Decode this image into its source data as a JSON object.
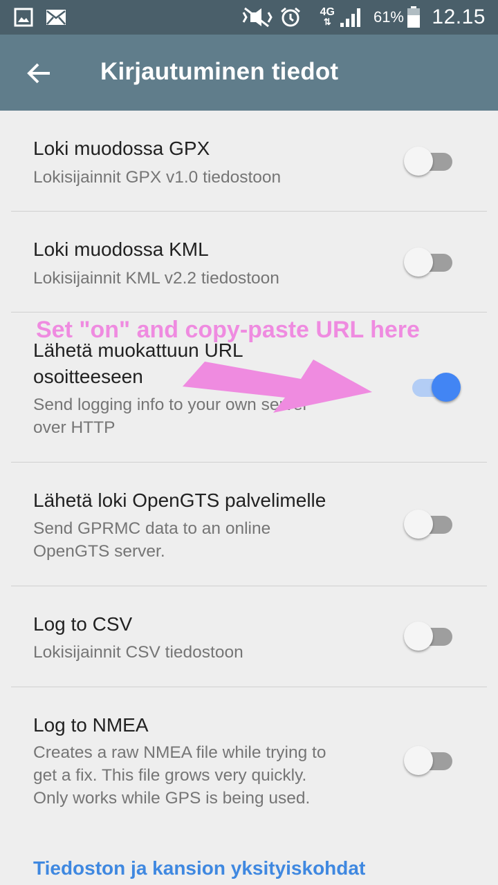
{
  "status_bar": {
    "network": "4G",
    "battery_percent": "61%",
    "time": "12.15",
    "icons": [
      "gallery-icon",
      "mail-icon",
      "mute-icon",
      "alarm-icon",
      "signal-icon",
      "battery-icon"
    ]
  },
  "app_bar": {
    "title": "Kirjautuminen tiedot",
    "back_icon": "arrow-back-icon"
  },
  "colors": {
    "status_bar": "#4a5f6a",
    "app_bar": "#607d8b",
    "switch_on": "#4285f4",
    "annotation": "#ef8be0",
    "link": "#3f88e0"
  },
  "preferences": [
    {
      "title": "Loki muodossa GPX",
      "summary": "Lokisijainnit GPX v1.0 tiedostoon",
      "enabled": false
    },
    {
      "title": "Loki muodossa KML",
      "summary": "Lokisijainnit KML v2.2 tiedostoon",
      "enabled": false
    },
    {
      "title": "Lähetä muokattuun URL\nosoitteeseen",
      "summary": "Send logging info to your own server\nover HTTP",
      "enabled": true
    },
    {
      "title": "Lähetä loki OpenGTS palvelimelle",
      "summary": "Send GPRMC data to an online\nOpenGTS server.",
      "enabled": false
    },
    {
      "title": "Log to CSV",
      "summary": "Lokisijainnit CSV tiedostoon",
      "enabled": false
    },
    {
      "title": "Log to NMEA",
      "summary": "Creates a raw NMEA file while trying to\nget a fix. This file grows very quickly.\nOnly works while GPS is being used.",
      "enabled": false
    }
  ],
  "annotation": {
    "text": "Set \"on\" and copy-paste URL here"
  },
  "footer_link": "Tiedoston ja kansion yksityiskohdat"
}
